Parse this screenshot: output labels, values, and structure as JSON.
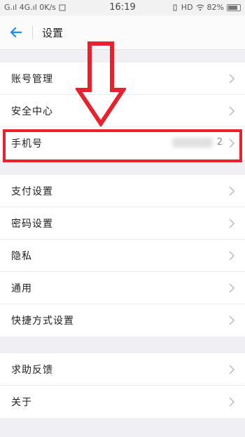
{
  "status_bar": {
    "left_text": "G.ıl 4G.ıl 0K/s",
    "time": "16:19",
    "right_text": "HD",
    "battery": "82%",
    "battery_level": 0.82
  },
  "header": {
    "title": "设置",
    "back_icon": "arrow-left-icon"
  },
  "groups": [
    {
      "items": [
        {
          "label": "账号管理"
        },
        {
          "label": "安全中心"
        },
        {
          "label": "手机号",
          "value": "2",
          "highlighted": true
        }
      ]
    },
    {
      "items": [
        {
          "label": "支付设置"
        },
        {
          "label": "密码设置"
        },
        {
          "label": "隐私"
        },
        {
          "label": "通用"
        },
        {
          "label": "快捷方式设置"
        }
      ]
    },
    {
      "items": [
        {
          "label": "求助反馈"
        },
        {
          "label": "关于"
        }
      ]
    }
  ],
  "colors": {
    "accent": "#1a8cff",
    "annotation": "#e8212e",
    "background": "#efeff4"
  }
}
